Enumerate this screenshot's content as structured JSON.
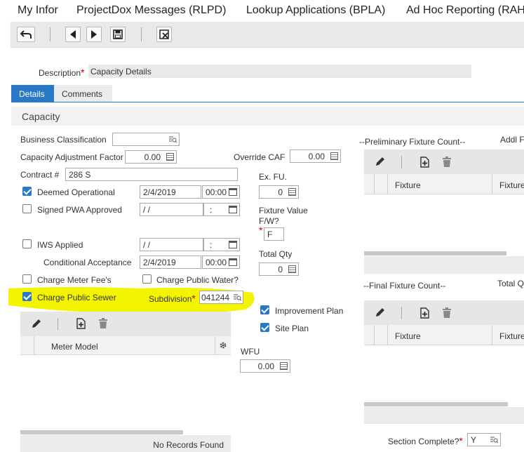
{
  "topnav": [
    "My Infor",
    "ProjectDox Messages (RLPD)",
    "Lookup Applications (BPLA)",
    "Ad Hoc Reporting (RAHI"
  ],
  "description": {
    "label": "Description",
    "value": "Capacity Details"
  },
  "tabs": [
    {
      "label": "Details",
      "active": true
    },
    {
      "label": "Comments",
      "active": false
    }
  ],
  "section_title": "Capacity",
  "fields": {
    "business_classification": {
      "label": "Business Classification",
      "value": ""
    },
    "capacity_adjustment_factor": {
      "label": "Capacity Adjustment Factor",
      "value": "0.00"
    },
    "override_caf": {
      "label": "Override CAF",
      "value": "0.00"
    },
    "contract": {
      "label": "Contract #",
      "value": "286 S"
    },
    "deemed_operational": {
      "label": "Deemed Operational",
      "checked": true,
      "date": "2/4/2019",
      "time": "00:00"
    },
    "signed_pwa_approved": {
      "label": "Signed PWA Approved",
      "checked": false,
      "date": " / /",
      "time": ":"
    },
    "ex_fu": {
      "label": "Ex. FU.",
      "value": "0"
    },
    "fixture_value": {
      "label_1": "Fixture Value",
      "label_2": "F/W?",
      "value": "F"
    },
    "iws_applied": {
      "label": "IWS Applied",
      "checked": false,
      "date": " / /",
      "time": ":"
    },
    "conditional_acceptance": {
      "label": "Conditional Acceptance",
      "date": "2/4/2019",
      "time": "00:00"
    },
    "total_qty": {
      "label": "Total Qty",
      "value": "0"
    },
    "charge_meter_fees": {
      "label": "Charge Meter Fee's",
      "checked": false
    },
    "charge_public_water": {
      "label": "Charge Public Water?",
      "checked": false
    },
    "charge_public_sewer": {
      "label": "Charge Public Sewer",
      "checked": true
    },
    "subdivision": {
      "label": "Subdivision",
      "value": "041244"
    },
    "improvement_plan": {
      "label": "Improvement Plan",
      "checked": true
    },
    "site_plan": {
      "label": "Site Plan",
      "checked": true
    },
    "wfu": {
      "label": "WFU",
      "value": "0.00"
    },
    "section_complete": {
      "label": "Section Complete?",
      "value": "Y"
    }
  },
  "meter_grid": {
    "column": "Meter Model",
    "empty_text": "No Records Found"
  },
  "preliminary_fixture": {
    "title": "--Preliminary Fixture Count--",
    "columns": [
      "Fixture",
      "Fixture"
    ],
    "side_title": "Addl F"
  },
  "final_fixture": {
    "title": "--Final Fixture Count--",
    "columns": [
      "Fixture",
      "Fixture"
    ],
    "side_title": "Total Q"
  },
  "colors": {
    "highlight": "#f4f400",
    "accent": "#2a78c8",
    "required": "#c00000"
  }
}
